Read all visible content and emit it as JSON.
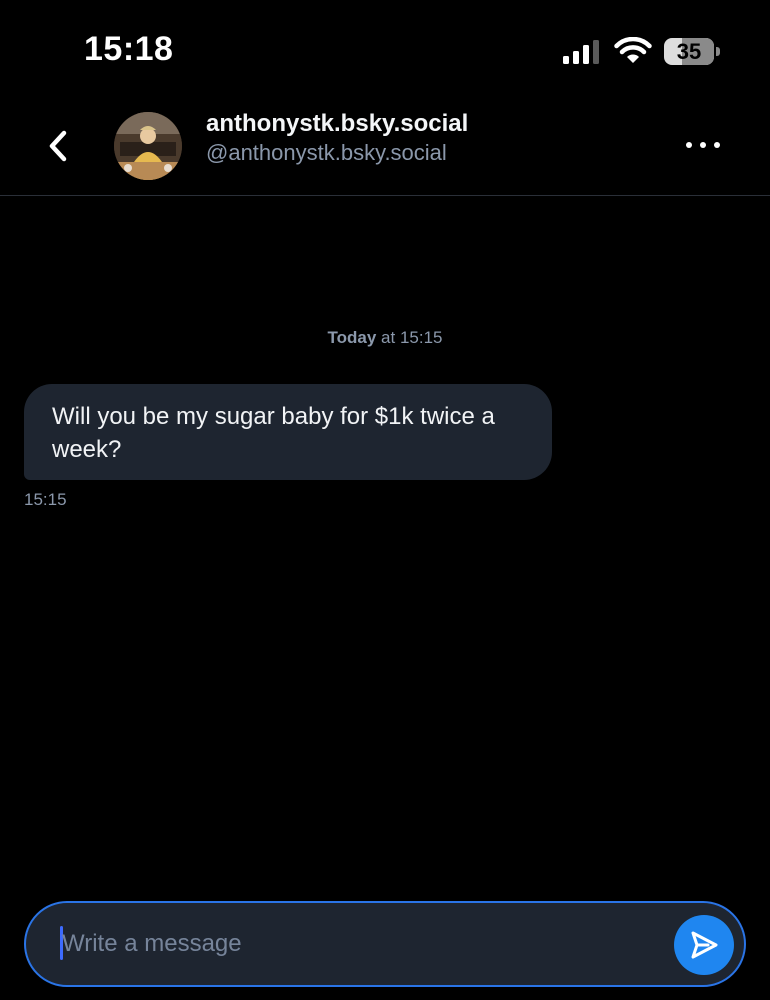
{
  "status_bar": {
    "time": "15:18",
    "battery_level": "35",
    "icons": [
      "signal-icon",
      "wifi-icon",
      "battery-icon"
    ]
  },
  "header": {
    "display_name": "anthonystk.bsky.social",
    "handle": "@anthonystk.bsky.social",
    "icons": [
      "chevron-left-icon",
      "more-horizontal-icon"
    ]
  },
  "conversation": {
    "date_divider": {
      "day": "Today",
      "time": "at 15:15"
    },
    "messages": [
      {
        "text": "Will you be my sugar baby for $1k twice a week?",
        "time": "15:15"
      }
    ]
  },
  "composer": {
    "placeholder": "Write a message",
    "value": "",
    "send_icon": "send-icon"
  },
  "colors": {
    "background": "#000000",
    "bubble": "#1e2530",
    "muted_text": "#8b98ab",
    "accent": "#1f86f0",
    "composer_border": "#2a74e6"
  }
}
